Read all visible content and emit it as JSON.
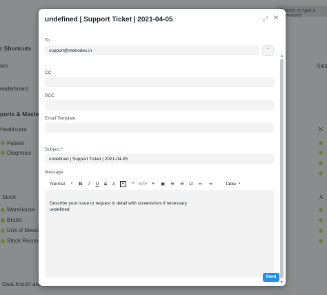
{
  "background": {
    "search_placeholder": "Search or type a command",
    "items": [
      "r Shortcuts",
      "em",
      "eaderboard",
      "ports & Masters",
      "Healthcare",
      "Patient",
      "Diagnosis",
      "Stock",
      "Warehouse",
      "Brand",
      "Unit of Measure",
      "Stock Reconcili",
      "Data Import and",
      "Sale",
      "N",
      "A"
    ]
  },
  "modal": {
    "title": "undefined | Support Ticket | 2021-04-05",
    "to_label": "To",
    "to_value": "support@metrodex.in",
    "cc_label": "CC",
    "cc_value": "",
    "bcc_label": "BCC",
    "bcc_value": "",
    "template_label": "Email Template",
    "template_value": "",
    "subject_label": "Subject *",
    "subject_value": "undefined | Support Ticket | 2021-04-05",
    "message_label": "Message",
    "toolbar": {
      "format": "Normal",
      "table": "Table"
    },
    "message_line1": "Describe your issue or request in detail with screenshots if necessary",
    "message_line2": "undefined",
    "send_label": "Send"
  },
  "colors": {
    "accent": "#2490ef",
    "field_bg": "#f3f3f4",
    "overlay": "#8a8c8e"
  }
}
